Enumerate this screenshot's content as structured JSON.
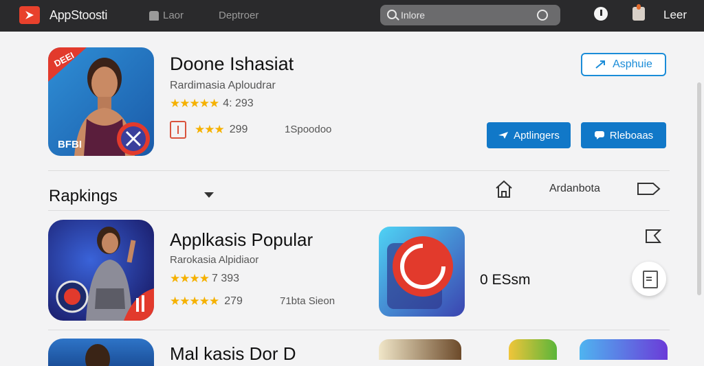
{
  "topbar": {
    "app_name": "AppStoosti",
    "nav_item_1": "Laor",
    "nav_item_2": "Deptroer",
    "search_placeholder": "Inlore",
    "user_label": "Leer"
  },
  "featured": {
    "badge": "DEEI",
    "image_caption": "BFBI",
    "title": "Doone Ishasiat",
    "subtitle": "Rardimasia Aploudrar",
    "rating_value": "4: 293",
    "rating_count": "299",
    "size": "1Spoodoo",
    "apply_outline_label": "Asphuie",
    "apply_button_label": "Aptlingers",
    "release_button_label": "Rleboaas"
  },
  "rankings": {
    "title": "Rapkings",
    "alt_label": "Ardanbota"
  },
  "popular": {
    "title": "Applkasis Popular",
    "subtitle": "Rarokasia Alpidiaor",
    "rating_value": "7 393",
    "rating_count": "279",
    "size": "71bta Sieon",
    "app2_label": "0 ESsm"
  },
  "next": {
    "title": "Mal kasis Dor D"
  },
  "colors": {
    "topbar_bg": "#2a2a2c",
    "accent_blue": "#1178c8",
    "star": "#f5b100",
    "logo_red": "#e8412c"
  }
}
